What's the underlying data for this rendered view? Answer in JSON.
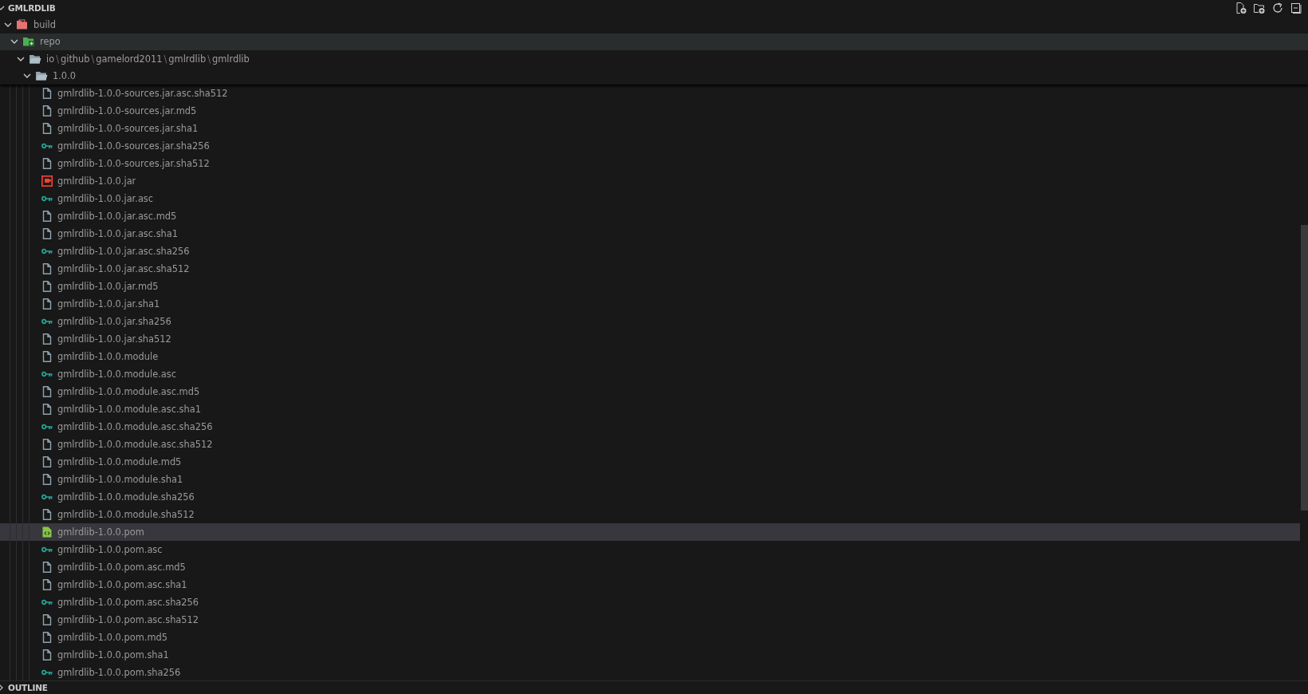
{
  "explorer": {
    "title": "GMLRDLIB",
    "expanded": true,
    "toolbar": [
      {
        "kind": "new-file"
      },
      {
        "kind": "new-folder"
      },
      {
        "kind": "refresh"
      },
      {
        "kind": "collapse"
      }
    ],
    "tree": [
      {
        "kind": "folder-build",
        "name": "build",
        "expanded": true,
        "selected": false,
        "children": [
          {
            "kind": "folder-repo",
            "name": "repo",
            "expanded": true,
            "selected": false,
            "hovered": true,
            "children": [
              {
                "kind": "folder",
                "segments": [
                  "io",
                  "github",
                  "gamelord2011",
                  "gmlrdlib",
                  "gmlrdlib"
                ],
                "separator": "\\",
                "expanded": true,
                "selected": false,
                "children": [
                  {
                    "kind": "folder",
                    "name": "1.0.0",
                    "expanded": true,
                    "selected": false,
                    "children": [
                      {
                        "kind": "file",
                        "name": "gmlrdlib-1.0.0-sources.jar.asc.sha512",
                        "selected": false
                      },
                      {
                        "kind": "file",
                        "name": "gmlrdlib-1.0.0-sources.jar.md5",
                        "selected": false
                      },
                      {
                        "kind": "file",
                        "name": "gmlrdlib-1.0.0-sources.jar.sha1",
                        "selected": false
                      },
                      {
                        "kind": "key",
                        "name": "gmlrdlib-1.0.0-sources.jar.sha256",
                        "selected": false
                      },
                      {
                        "kind": "file",
                        "name": "gmlrdlib-1.0.0-sources.jar.sha512",
                        "selected": false
                      },
                      {
                        "kind": "jar",
                        "name": "gmlrdlib-1.0.0.jar",
                        "selected": false
                      },
                      {
                        "kind": "key",
                        "name": "gmlrdlib-1.0.0.jar.asc",
                        "selected": false
                      },
                      {
                        "kind": "file",
                        "name": "gmlrdlib-1.0.0.jar.asc.md5",
                        "selected": false
                      },
                      {
                        "kind": "file",
                        "name": "gmlrdlib-1.0.0.jar.asc.sha1",
                        "selected": false
                      },
                      {
                        "kind": "key",
                        "name": "gmlrdlib-1.0.0.jar.asc.sha256",
                        "selected": false
                      },
                      {
                        "kind": "file",
                        "name": "gmlrdlib-1.0.0.jar.asc.sha512",
                        "selected": false
                      },
                      {
                        "kind": "file",
                        "name": "gmlrdlib-1.0.0.jar.md5",
                        "selected": false
                      },
                      {
                        "kind": "file",
                        "name": "gmlrdlib-1.0.0.jar.sha1",
                        "selected": false
                      },
                      {
                        "kind": "key",
                        "name": "gmlrdlib-1.0.0.jar.sha256",
                        "selected": false
                      },
                      {
                        "kind": "file",
                        "name": "gmlrdlib-1.0.0.jar.sha512",
                        "selected": false
                      },
                      {
                        "kind": "file",
                        "name": "gmlrdlib-1.0.0.module",
                        "selected": false
                      },
                      {
                        "kind": "key",
                        "name": "gmlrdlib-1.0.0.module.asc",
                        "selected": false
                      },
                      {
                        "kind": "file",
                        "name": "gmlrdlib-1.0.0.module.asc.md5",
                        "selected": false
                      },
                      {
                        "kind": "file",
                        "name": "gmlrdlib-1.0.0.module.asc.sha1",
                        "selected": false
                      },
                      {
                        "kind": "key",
                        "name": "gmlrdlib-1.0.0.module.asc.sha256",
                        "selected": false
                      },
                      {
                        "kind": "file",
                        "name": "gmlrdlib-1.0.0.module.asc.sha512",
                        "selected": false
                      },
                      {
                        "kind": "file",
                        "name": "gmlrdlib-1.0.0.module.md5",
                        "selected": false
                      },
                      {
                        "kind": "file",
                        "name": "gmlrdlib-1.0.0.module.sha1",
                        "selected": false
                      },
                      {
                        "kind": "key",
                        "name": "gmlrdlib-1.0.0.module.sha256",
                        "selected": false
                      },
                      {
                        "kind": "file",
                        "name": "gmlrdlib-1.0.0.module.sha512",
                        "selected": false
                      },
                      {
                        "kind": "pom",
                        "name": "gmlrdlib-1.0.0.pom",
                        "selected": true
                      },
                      {
                        "kind": "key",
                        "name": "gmlrdlib-1.0.0.pom.asc",
                        "selected": false
                      },
                      {
                        "kind": "file",
                        "name": "gmlrdlib-1.0.0.pom.asc.md5",
                        "selected": false
                      },
                      {
                        "kind": "file",
                        "name": "gmlrdlib-1.0.0.pom.asc.sha1",
                        "selected": false
                      },
                      {
                        "kind": "key",
                        "name": "gmlrdlib-1.0.0.pom.asc.sha256",
                        "selected": false
                      },
                      {
                        "kind": "file",
                        "name": "gmlrdlib-1.0.0.pom.asc.sha512",
                        "selected": false
                      },
                      {
                        "kind": "file",
                        "name": "gmlrdlib-1.0.0.pom.md5",
                        "selected": false
                      },
                      {
                        "kind": "file",
                        "name": "gmlrdlib-1.0.0.pom.sha1",
                        "selected": false
                      },
                      {
                        "kind": "key",
                        "name": "gmlrdlib-1.0.0.pom.sha256",
                        "selected": false
                      }
                    ]
                  }
                ]
              }
            ]
          }
        ]
      }
    ]
  },
  "outline": {
    "title": "OUTLINE",
    "expanded": false
  }
}
